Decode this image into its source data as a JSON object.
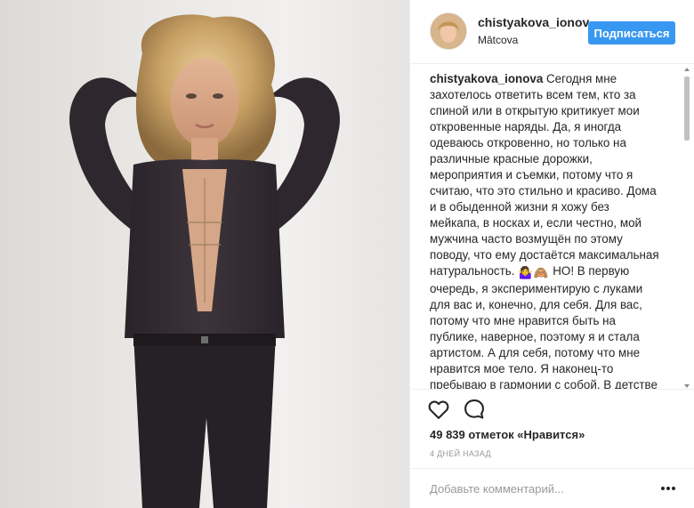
{
  "post": {
    "username": "chistyakova_ionov",
    "location": "Mâtcova",
    "follow_label": "Подписаться",
    "caption_username": "chistyakova_ionova",
    "caption_part1": " Сегодня мне захотелось ответить всем тем, кто за спиной или в открытую критикует мои откровенные наряды. Да, я иногда одеваюсь откровенно, но только на различные красные дорожки, мероприятия и съемки, потому что я считаю, что это стильно и красиво. Дома и в обыденной жизни я хожу без мейкапа, в носках и, если честно, мой мужчина часто возмущён по этому поводу, что ему достаётся максимальная натуральность. ",
    "caption_emojis": [
      "🤷‍♀️",
      "🙈"
    ],
    "caption_part2": " НО! В первую очередь, я экспериментирую с луками для вас и, конечно, для себя. Для вас, потому что мне нравится быть на публике, наверное, поэтому я и стала артистом. А для себя, потому что мне нравится мое тело. Я наконец-то пребываю в гармонии с собой. В детстве я надевала три пары колготок для того,",
    "likes_text": "49 839 отметок «Нравится»",
    "timestamp": "4 дней назад",
    "comment_placeholder": "Добавьте комментарий..."
  },
  "icons": {
    "like": "heart-outline-icon",
    "comment": "speech-bubble-icon",
    "more": "ellipsis-icon"
  },
  "colors": {
    "follow_button": "#3897f0",
    "text": "#262626",
    "muted": "#999999"
  }
}
